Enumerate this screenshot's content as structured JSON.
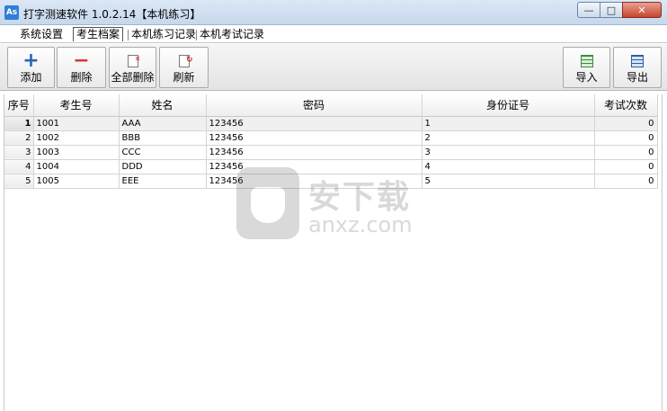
{
  "window": {
    "icon_text": "As",
    "title": "打字测速软件  1.0.2.14【本机练习】",
    "minimize": "—",
    "maximize": "□",
    "close": "✕"
  },
  "tabs": [
    {
      "label": "系统设置",
      "active": false
    },
    {
      "label": "考生档案",
      "active": true
    },
    {
      "label": "本机练习记录",
      "active": false
    },
    {
      "label": "本机考试记录",
      "active": false
    }
  ],
  "toolbar": {
    "add_label": "添加",
    "add_icon": "plus-icon",
    "delete_label": "删除",
    "delete_icon": "minus-icon",
    "delete_all_label": "全部删除",
    "delete_all_icon": "document-delete-icon",
    "refresh_label": "刷新",
    "refresh_icon": "document-refresh-icon",
    "import_label": "导入",
    "import_icon": "excel-import-icon",
    "export_label": "导出",
    "export_icon": "excel-export-icon"
  },
  "table": {
    "columns": [
      "序号",
      "考生号",
      "姓名",
      "密码",
      "身份证号",
      "考试次数"
    ],
    "rows": [
      {
        "index": "1",
        "id": "1001",
        "name": "AAA",
        "password": "123456",
        "id_card": "1",
        "exam_count": "0"
      },
      {
        "index": "2",
        "id": "1002",
        "name": "BBB",
        "password": "123456",
        "id_card": "2",
        "exam_count": "0"
      },
      {
        "index": "3",
        "id": "1003",
        "name": "CCC",
        "password": "123456",
        "id_card": "3",
        "exam_count": "0"
      },
      {
        "index": "4",
        "id": "1004",
        "name": "DDD",
        "password": "123456",
        "id_card": "4",
        "exam_count": "0"
      },
      {
        "index": "5",
        "id": "1005",
        "name": "EEE",
        "password": "123456",
        "id_card": "5",
        "exam_count": "0"
      }
    ],
    "selected_row": 1
  },
  "watermark": {
    "text_cn": "安下载",
    "text_en": "anxz.com"
  }
}
